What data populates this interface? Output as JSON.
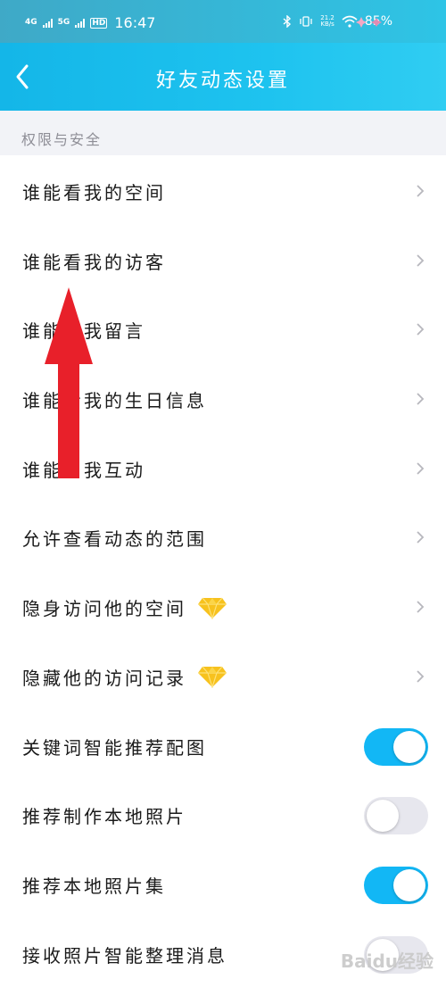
{
  "status_bar": {
    "signal1": "4G",
    "signal2": "5G",
    "hd": "HD",
    "time": "16:47",
    "net_speed_value": "21.2",
    "net_speed_unit": "KB/s",
    "battery": "85%"
  },
  "nav": {
    "back_icon": "chevron-left-icon",
    "title": "好友动态设置"
  },
  "section": {
    "title": "权限与安全"
  },
  "items": [
    {
      "label": "谁能看我的空间",
      "control": "chevron"
    },
    {
      "label": "谁能看我的访客",
      "control": "chevron"
    },
    {
      "label": "谁能看我留言",
      "control": "chevron"
    },
    {
      "label": "谁能看我的生日信息",
      "control": "chevron"
    },
    {
      "label": "谁能与我互动",
      "control": "chevron"
    },
    {
      "label": "允许查看动态的范围",
      "control": "chevron"
    },
    {
      "label": "隐身访问他的空间",
      "control": "chevron",
      "badge": "yellow-diamond-icon"
    },
    {
      "label": "隐藏他的访问记录",
      "control": "chevron",
      "badge": "yellow-diamond-icon"
    },
    {
      "label": "关键词智能推荐配图",
      "control": "toggle",
      "on": true
    },
    {
      "label": "推荐制作本地照片",
      "control": "toggle",
      "on": false
    },
    {
      "label": "推荐本地照片集",
      "control": "toggle",
      "on": true
    },
    {
      "label": "接收照片智能整理消息",
      "control": "toggle",
      "on": false
    }
  ],
  "colors": {
    "accent": "#12b7f5",
    "annotation_arrow": "#e8202a"
  },
  "watermark": "Baidu经验"
}
